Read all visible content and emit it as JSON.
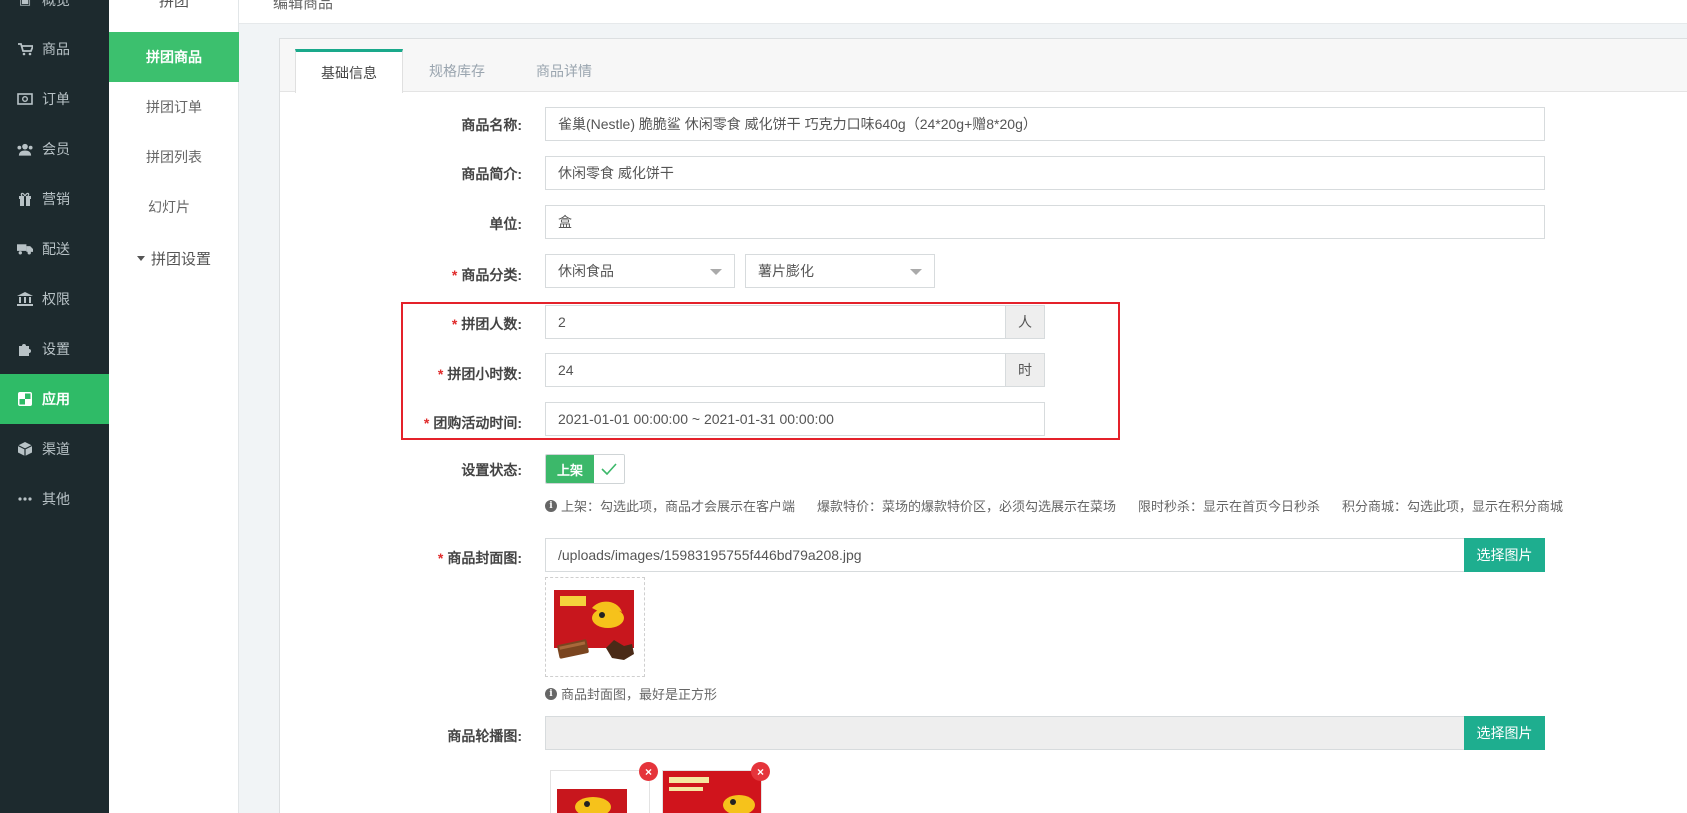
{
  "nav": {
    "items": [
      {
        "label": "概览",
        "icon": "dashboard-icon"
      },
      {
        "label": "商品",
        "icon": "cart-icon"
      },
      {
        "label": "订单",
        "icon": "money-icon"
      },
      {
        "label": "会员",
        "icon": "users-icon"
      },
      {
        "label": "营销",
        "icon": "gift-icon"
      },
      {
        "label": "配送",
        "icon": "truck-icon"
      },
      {
        "label": "权限",
        "icon": "bank-icon"
      },
      {
        "label": "设置",
        "icon": "puzzle-icon"
      },
      {
        "label": "应用",
        "icon": "apps-icon"
      },
      {
        "label": "渠道",
        "icon": "cube-icon"
      },
      {
        "label": "其他",
        "icon": "more-icon"
      }
    ],
    "active": "应用"
  },
  "subnav": {
    "top_label": "拼团",
    "items": [
      "拼团商品",
      "拼团订单",
      "拼团列表",
      "幻灯片"
    ],
    "group": "拼团设置"
  },
  "page": {
    "title": "编辑商品"
  },
  "tabs": [
    "基础信息",
    "规格库存",
    "商品详情"
  ],
  "form": {
    "name_label": "商品名称:",
    "name_value": "雀巢(Nestle) 脆脆鲨 休闲零食 威化饼干 巧克力口味640g（24*20g+赠8*20g）",
    "intro_label": "商品简介:",
    "intro_value": "休闲零食 威化饼干",
    "unit_label": "单位:",
    "unit_value": "盒",
    "category_label": "商品分类:",
    "category_1": "休闲食品",
    "category_2": "薯片膨化",
    "group_size_label": "拼团人数:",
    "group_size_value": "2",
    "group_size_unit": "人",
    "group_hours_label": "拼团小时数:",
    "group_hours_value": "24",
    "group_hours_unit": "时",
    "period_label": "团购活动时间:",
    "period_value": "2021-01-01 00:00:00 ~ 2021-01-31 00:00:00",
    "status_label": "设置状态:",
    "status_on": "上架",
    "status_hints": [
      "上架：勾选此项，商品才会展示在客户端",
      "爆款特价：菜场的爆款特价区，必须勾选展示在菜场",
      "限时秒杀：显示在首页今日秒杀",
      "积分商城：勾选此项，显示在积分商城"
    ],
    "cover_label": "商品封面图:",
    "cover_value": "/uploads/images/15983195755f446bd79a208.jpg",
    "cover_button": "选择图片",
    "cover_hint": "商品封面图，最好是正方形",
    "carousel_label": "商品轮播图:",
    "carousel_button": "选择图片",
    "delete_symbol": "×"
  },
  "colors": {
    "accent": "#2fbb67",
    "teal": "#1eae8f",
    "highlight": "#e4212a",
    "nav_bg": "#1d2a2e"
  }
}
